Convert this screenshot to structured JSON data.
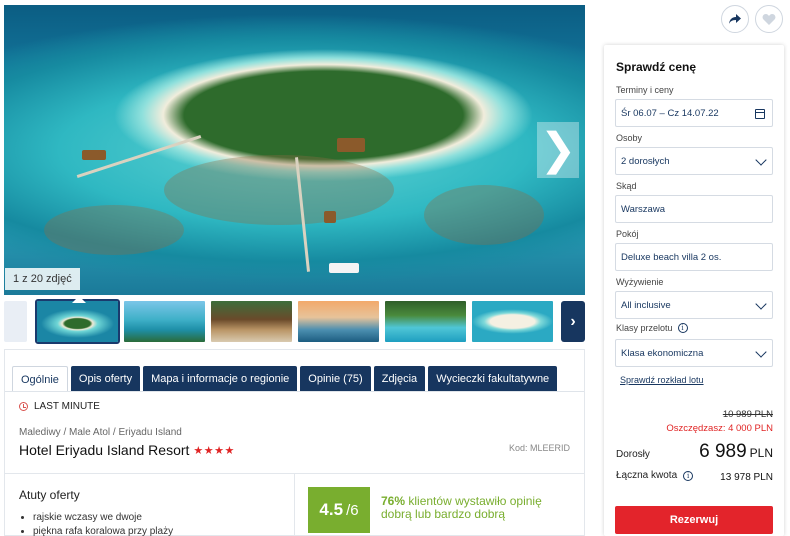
{
  "gallery": {
    "photo_count": "1 z 20 zdjęć",
    "next_glyph": "❯",
    "thumb_next_glyph": "›"
  },
  "tabs": [
    {
      "label": "Ogólnie",
      "active": true
    },
    {
      "label": "Opis oferty"
    },
    {
      "label": "Mapa i informacje o regionie"
    },
    {
      "label": "Opinie (75)"
    },
    {
      "label": "Zdjęcia"
    },
    {
      "label": "Wycieczki fakultatywne"
    }
  ],
  "offer": {
    "badge": "LAST MINUTE",
    "breadcrumb": "Malediwy / Male Atol / Eriyadu Island",
    "hotel_name": "Hotel Eriyadu Island Resort",
    "stars": "★★★★",
    "code": "Kod: MLEERID"
  },
  "highlights": {
    "title": "Atuty oferty",
    "items": [
      "rajskie wczasy we dwoje",
      "piękna rafa koralowa przy plaży"
    ]
  },
  "rating": {
    "score": "4.5",
    "scale": "/6",
    "percent": "76%",
    "text": "klientów wystawiło opinię dobrą lub bardzo dobrą"
  },
  "booking": {
    "title": "Sprawdź cenę",
    "dates_label": "Terminy i ceny",
    "dates_value": "Śr 06.07 – Cz 14.07.22",
    "persons_label": "Osoby",
    "persons_value": "2 dorosłych",
    "from_label": "Skąd",
    "from_value": "Warszawa",
    "room_label": "Pokój",
    "room_value": "Deluxe beach villa 2 os.",
    "board_label": "Wyżywienie",
    "board_value": "All inclusive",
    "flight_label": "Klasy przelotu",
    "flight_value": "Klasa ekonomiczna",
    "schedule_link": "Sprawdź rozkład lotu",
    "old_price": "10 989  PLN",
    "savings": "Oszczędzasz: 4 000 PLN",
    "adult_label": "Dorosły",
    "adult_price": "6 989",
    "currency": "PLN",
    "total_label": "Łączna kwota",
    "total_value": "13 978 PLN",
    "book_button": "Rezerwuj"
  },
  "colors": {
    "navy": "#17365f",
    "accent_red": "#e3242b",
    "rating_green": "#79ae2f"
  },
  "icons": [
    "share-icon",
    "heart-icon",
    "chevron-right-icon",
    "clock-icon",
    "calendar-icon",
    "chevron-down-icon",
    "info-icon"
  ]
}
